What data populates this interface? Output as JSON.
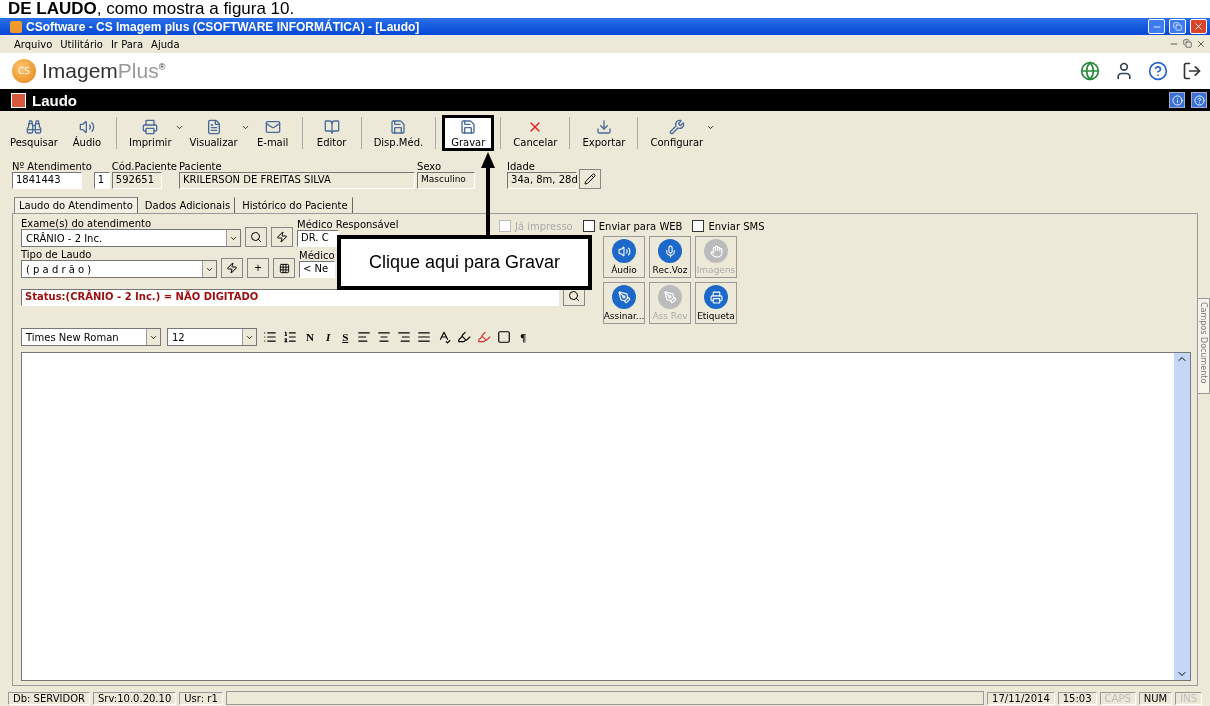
{
  "caption": "**DE LAUDO**, como mostra a figura 10.",
  "window": {
    "title": "CSoftware - CS Imagem plus (CSOFTWARE INFORMÁTICA) - [Laudo]"
  },
  "menu": [
    "Arquivo",
    "Utilitário",
    "Ir Para",
    "Ajuda"
  ],
  "brand": {
    "name": "Imagem",
    "suffix": "Plus",
    "mark": "®",
    "logo": "CS"
  },
  "module": {
    "title": "Laudo"
  },
  "toolbar": [
    {
      "label": "Pesquisar",
      "kind": "search",
      "dropdown": false,
      "highlighted": false
    },
    {
      "label": "Áudio",
      "kind": "audio",
      "dropdown": false,
      "highlighted": false
    },
    {
      "label": "Imprimir",
      "kind": "print",
      "dropdown": true,
      "highlighted": false
    },
    {
      "label": "Visualizar",
      "kind": "view",
      "dropdown": true,
      "highlighted": false
    },
    {
      "label": "E-mail",
      "kind": "mail",
      "dropdown": false,
      "highlighted": false
    },
    {
      "label": "Editor",
      "kind": "editor",
      "dropdown": false,
      "highlighted": false
    },
    {
      "label": "Disp.Méd.",
      "kind": "disp",
      "dropdown": false,
      "highlighted": false
    },
    {
      "label": "Gravar",
      "kind": "save",
      "dropdown": false,
      "highlighted": true
    },
    {
      "label": "Cancelar",
      "kind": "cancel",
      "dropdown": false,
      "highlighted": false
    },
    {
      "label": "Exportar",
      "kind": "export",
      "dropdown": false,
      "highlighted": false
    },
    {
      "label": "Configurar",
      "kind": "config",
      "dropdown": true,
      "highlighted": false
    }
  ],
  "patient": [
    {
      "label": "Nº Atendimento",
      "value": "1841443"
    },
    {
      "value": "1"
    },
    {
      "label": "Cód.Paciente",
      "value": "592651"
    },
    {
      "label": "Paciente",
      "value": "KRILERSON DE FREITAS SILVA"
    },
    {
      "label": "Sexo",
      "value": "Masculino"
    },
    {
      "label": "Idade",
      "value": "34a, 8m, 28d"
    }
  ],
  "tabs": [
    {
      "label": "Laudo do Atendimento",
      "selected": true
    },
    {
      "label": "Dados Adicionais",
      "selected": false
    },
    {
      "label": "Histórico do Paciente",
      "selected": false
    }
  ],
  "form": {
    "exam_label": "Exame(s) do atendimento",
    "exam_value": "CRÂNIO - 2 Inc.",
    "medico_label": "Médico Responsável",
    "medico_value": "DR. C",
    "tipo_label": "Tipo de Laudo",
    "tipo_value": "( p a d r ã o )",
    "plus": "+",
    "medico2_label": "Médico",
    "medico2_value": "< Ne",
    "status": "Status:(CRÂNIO - 2 Inc.) = NÃO DIGITADO"
  },
  "checkboxes": [
    {
      "label": "Já impresso",
      "checked": false,
      "disabled": true
    },
    {
      "label": "Enviar para WEB",
      "checked": false,
      "disabled": false
    },
    {
      "label": "Enviar SMS",
      "checked": false,
      "disabled": false
    }
  ],
  "actions": [
    {
      "label": "Áudio",
      "kind": "audio",
      "disabled": false
    },
    {
      "label": "Rec.Voz",
      "kind": "voice",
      "disabled": false
    },
    {
      "label": "Imagens",
      "kind": "images",
      "disabled": true
    },
    {
      "label": "Assinar...",
      "kind": "sign",
      "disabled": false
    },
    {
      "label": "Ass Rev",
      "kind": "signrev",
      "disabled": true
    },
    {
      "label": "Etiqueta",
      "kind": "label",
      "disabled": false
    }
  ],
  "editor": {
    "font": "Times New Roman",
    "size": "12",
    "format": [
      "N",
      "I",
      "S"
    ],
    "pilcrow": "¶"
  },
  "side_tab": "Campos Documento",
  "callout": {
    "text": "Clique aqui para Gravar"
  },
  "status_bar": [
    {
      "text": "Db: SERVIDOR",
      "disabled": false
    },
    {
      "text": "Srv:10.0.20.10",
      "disabled": false
    },
    {
      "text": "Usr: r1",
      "disabled": false
    }
  ],
  "status_right": [
    {
      "text": "17/11/2014",
      "disabled": false
    },
    {
      "text": "15:03",
      "disabled": false
    },
    {
      "text": "CAPS",
      "disabled": true
    },
    {
      "text": "NUM",
      "disabled": false
    },
    {
      "text": "INS",
      "disabled": true
    }
  ]
}
